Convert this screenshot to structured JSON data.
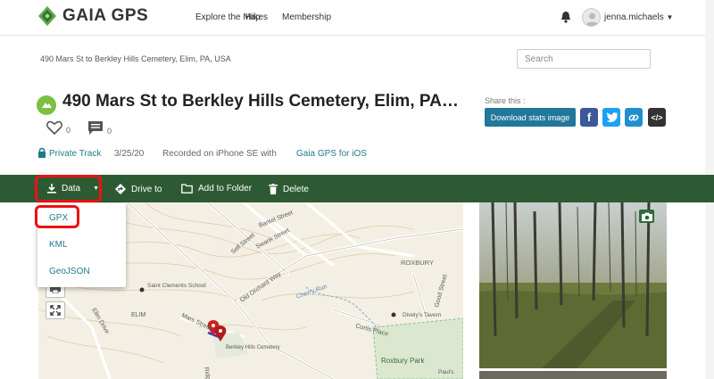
{
  "nav": {
    "brand": "GAIA GPS",
    "links": [
      "Explore the Map",
      "Hikes",
      "Membership"
    ],
    "username": "jenna.michaels"
  },
  "header": {
    "breadcrumb": "490 Mars St to Berkley Hills Cemetery, Elim, PA, USA",
    "search_placeholder": "Search",
    "title": "490 Mars St to Berkley Hills Cemetery, Elim, PA…",
    "likes": "0",
    "comments": "0",
    "privacy": "Private Track",
    "date": "3/25/20",
    "recorded": "Recorded on iPhone SE with",
    "app_link": "Gaia GPS for iOS",
    "share_label": "Share this :",
    "download_button": "Download stats image"
  },
  "toolbar": {
    "data": "Data",
    "drive": "Drive to",
    "add_folder": "Add to Folder",
    "delete": "Delete"
  },
  "data_menu": [
    "GPX",
    "KML",
    "GeoJSON"
  ],
  "map_labels": {
    "bantel": "Bantel Street",
    "swank": "Swank Street",
    "sell": "Sell Street",
    "old_orchard": "Old Orchard Way",
    "roxbury": "ROXBURY",
    "saint_clements": "Saint Clements School",
    "elim": "ELIM",
    "elim_drive": "Elim Drive",
    "mars_street": "Mars Street",
    "cherry_run": "Cherry Run",
    "dively": "Dively's Tavern",
    "curtis": "Curtis Place",
    "good_street": "Good Street",
    "berkley": "Berkley Hills Cemetery",
    "roxbury_park": "Roxbury Park",
    "pauls": "Paul's",
    "ridge_ave": "Ridge Ave"
  },
  "colors": {
    "toolbar": "#2e5a33",
    "link": "#1f7a8c",
    "primary_button": "#20789a",
    "highlight": "#ee1111"
  }
}
